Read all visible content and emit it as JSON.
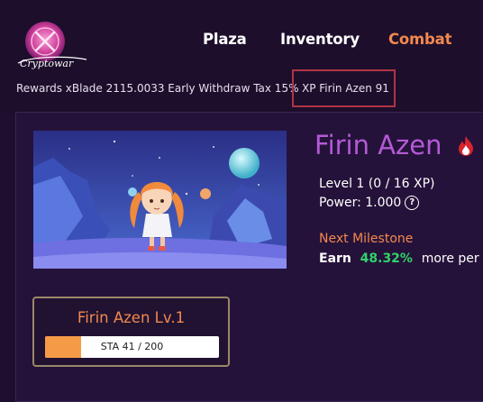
{
  "header": {
    "logo_text": "Cryptowars",
    "nav": {
      "plaza": "Plaza",
      "inventory": "Inventory",
      "combat": "Combat"
    },
    "rewards_text": "Rewards xBlade 2115.0033 Early Withdraw Tax 15%",
    "xp_text": "XP Firin Azen 91"
  },
  "character": {
    "name": "Firin Azen",
    "element_icon": "fire-icon",
    "level_text": "Level 1 (0 / 16 XP)",
    "power_text": "Power: 1.000",
    "next_milestone_label": "Next Milestone",
    "earn_prefix": "Earn",
    "earn_percent": "48.32%",
    "earn_suffix": "more per b"
  },
  "card": {
    "title": "Firin Azen Lv.1",
    "stamina_text": "STA 41 / 200",
    "stamina_fraction": 0.205
  },
  "colors": {
    "accent_orange": "#f2884e",
    "name_purple": "#b45ad6",
    "positive_green": "#2fd36a",
    "highlight_red": "#b03443"
  }
}
